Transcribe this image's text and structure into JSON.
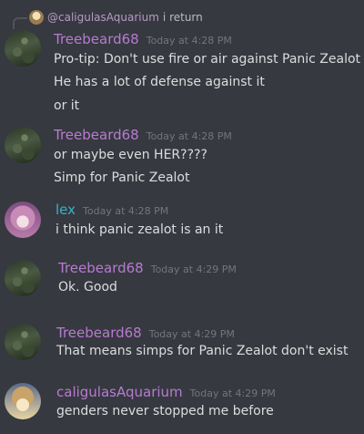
{
  "reply": {
    "username": "@caligulasAquarium",
    "text": "i return"
  },
  "groups": [
    {
      "username": "Treebeard68",
      "timestamp": "Today at 4:28 PM",
      "messages": [
        "Pro-tip: Don't use fire or air against Panic Zealot",
        "He has a lot of defense against it",
        "or it"
      ]
    },
    {
      "username": "Treebeard68",
      "timestamp": "Today at 4:28 PM",
      "messages": [
        "or maybe even HER????",
        "Simp for Panic Zealot"
      ]
    },
    {
      "username": "lex",
      "timestamp": "Today at 4:28 PM",
      "messages": [
        "i think panic zealot is an it"
      ]
    },
    {
      "username": "Treebeard68",
      "timestamp": "Today at 4:29 PM",
      "messages": [
        "Ok. Good"
      ]
    },
    {
      "username": "Treebeard68",
      "timestamp": "Today at 4:29 PM",
      "messages": [
        "That means simps for Panic Zealot don't exist"
      ]
    },
    {
      "username": "caligulasAquarium",
      "timestamp": "Today at 4:29 PM",
      "messages": [
        "genders never stopped me before"
      ]
    }
  ]
}
